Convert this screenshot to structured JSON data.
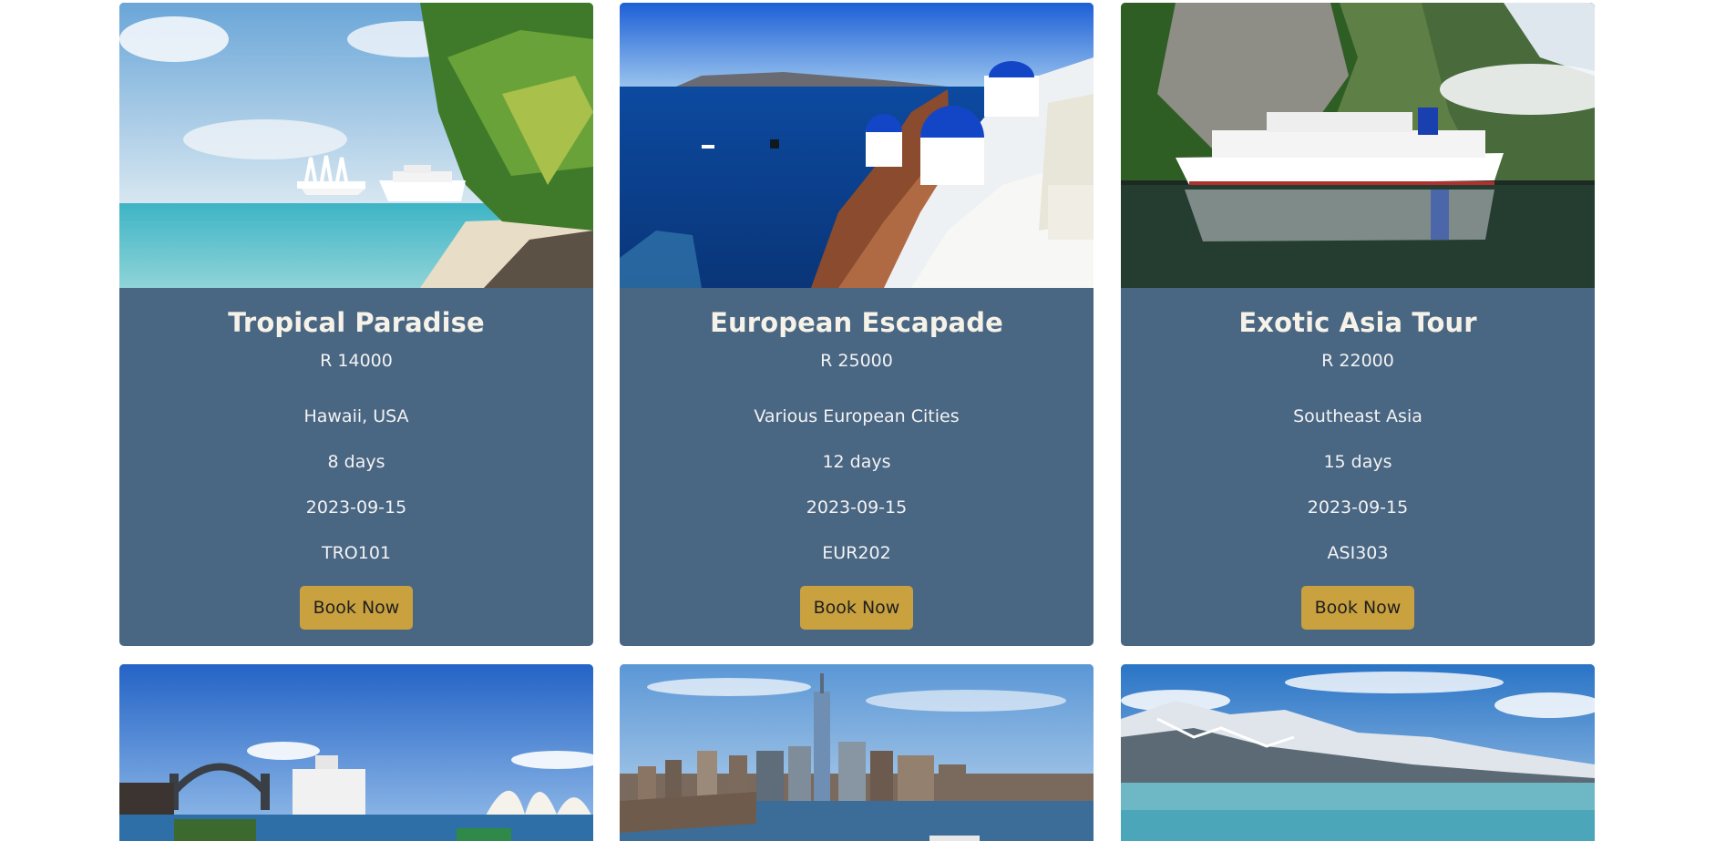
{
  "currency_prefix": "R",
  "book_label": "Book Now",
  "cruises": [
    {
      "name": "Tropical Paradise",
      "price": "R 14000",
      "location": "Hawaii, USA",
      "duration": "8 days",
      "date": "2023-09-15",
      "code": "TRO101"
    },
    {
      "name": "European Escapade",
      "price": "R 25000",
      "location": "Various European Cities",
      "duration": "12 days",
      "date": "2023-09-15",
      "code": "EUR202"
    },
    {
      "name": "Exotic Asia Tour",
      "price": "R 22000",
      "location": "Southeast Asia",
      "duration": "15 days",
      "date": "2023-09-15",
      "code": "ASI303"
    }
  ],
  "colors": {
    "card_background": "#496683",
    "button_background": "#c9a13f",
    "title_text": "#f6f2e8"
  }
}
